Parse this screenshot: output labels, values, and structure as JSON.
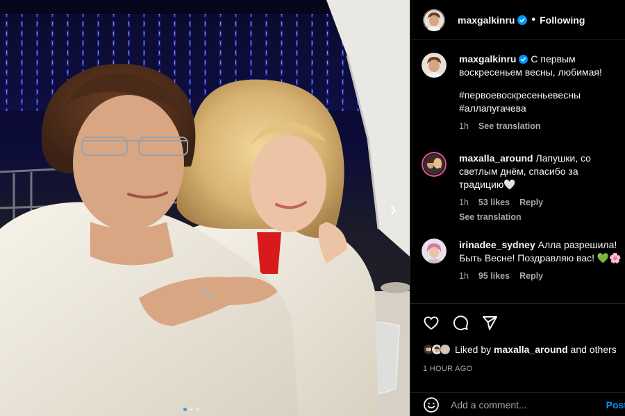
{
  "post": {
    "author": "maxgalkinru",
    "verified": true,
    "separator": "•",
    "follow_state": "Following"
  },
  "caption": {
    "username": "maxgalkinru",
    "text": "С первым воскресеньем весны, любимая!",
    "hashtags": "#первоевоскресеньевесны #аллапугачева",
    "time": "1h",
    "see_translation": "See translation"
  },
  "comments": [
    {
      "username": "maxalla_around",
      "text": "Лапушки, со светлым днём, спасибо за традицию🤍",
      "time": "1h",
      "likes": "53 likes",
      "reply": "Reply",
      "see_translation": "See translation"
    },
    {
      "username": "irinadee_sydney",
      "text": "Алла разрешила! Быть Весне! Поздравляю вас! 💚🌸",
      "time": "1h",
      "likes": "95 likes",
      "reply": "Reply"
    }
  ],
  "actions": {
    "icons": [
      "heart-icon",
      "comment-icon",
      "share-icon"
    ]
  },
  "likes_summary": {
    "prefix": "Liked by",
    "user": "maxalla_around",
    "suffix": "and others"
  },
  "posted_ago": "1 HOUR AGO",
  "add_comment": {
    "placeholder": "Add a comment...",
    "post_label": "Post"
  },
  "carousel": {
    "next_icon": "chevron-right-icon",
    "slide_count": 3,
    "active_slide": 1
  },
  "colors": {
    "background": "#000000",
    "text": "#f5f5f5",
    "secondary_text": "#a8a8a8",
    "divider": "#262626",
    "accent_blue": "#0095f6",
    "verified_blue": "#0095f6"
  }
}
